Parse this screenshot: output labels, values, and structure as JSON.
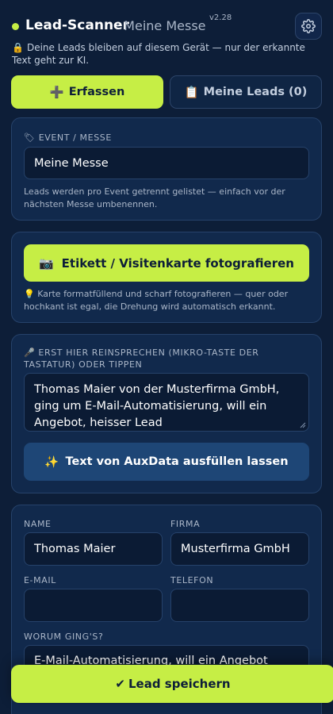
{
  "header": {
    "brand": "Lead-Scanner",
    "event_label": "· Meine Messe",
    "version": "v2.28",
    "privacy_icon": "🔒",
    "privacy_text": "Deine Leads bleiben auf diesem Gerät — nur der erkannte Text geht zur KI."
  },
  "tabs": {
    "capture": {
      "icon": "➕",
      "label": "Erfassen"
    },
    "leads": {
      "icon": "📋",
      "label": "Meine Leads (0)"
    }
  },
  "event": {
    "label_icon": "🏷",
    "label": "Event / Messe",
    "value": "Meine Messe",
    "hint": "Leads werden pro Event getrennt gelistet — einfach vor der nächsten Messe umbenennen."
  },
  "photo": {
    "button_icon": "📷",
    "button_label": "Etikett / Visitenkarte fotografieren",
    "hint_icon": "💡",
    "hint": "Karte formatfüllend und scharf fotografieren — quer oder hochkant ist egal, die Drehung wird automatisch erkannt."
  },
  "speech": {
    "label_icon": "🎤",
    "label": "Erst hier reinsprechen (Mikro-Taste der Tastatur) oder tippen",
    "value": "Thomas Maier von der Musterfirma GmbH, ging um E-Mail-Automatisierung, will ein Angebot, heisser Lead",
    "fill_icon": "✨",
    "fill_label": "Text von AuxData ausfüllen lassen"
  },
  "form": {
    "name_label": "Name",
    "name_value": "Thomas Maier",
    "company_label": "Firma",
    "company_value": "Musterfirma GmbH",
    "email_label": "E-Mail",
    "email_value": "",
    "phone_label": "Telefon",
    "phone_value": "",
    "topic_label": "Worum ging's?",
    "topic_value": "E-Mail-Automatisierung, will ein Angebot"
  },
  "save": {
    "icon": "✔",
    "label": "Lead speichern"
  },
  "colors": {
    "background": "#0d1e38",
    "card": "#11294c",
    "accent": "#c6ee45",
    "secondary_button": "#1e4676"
  }
}
